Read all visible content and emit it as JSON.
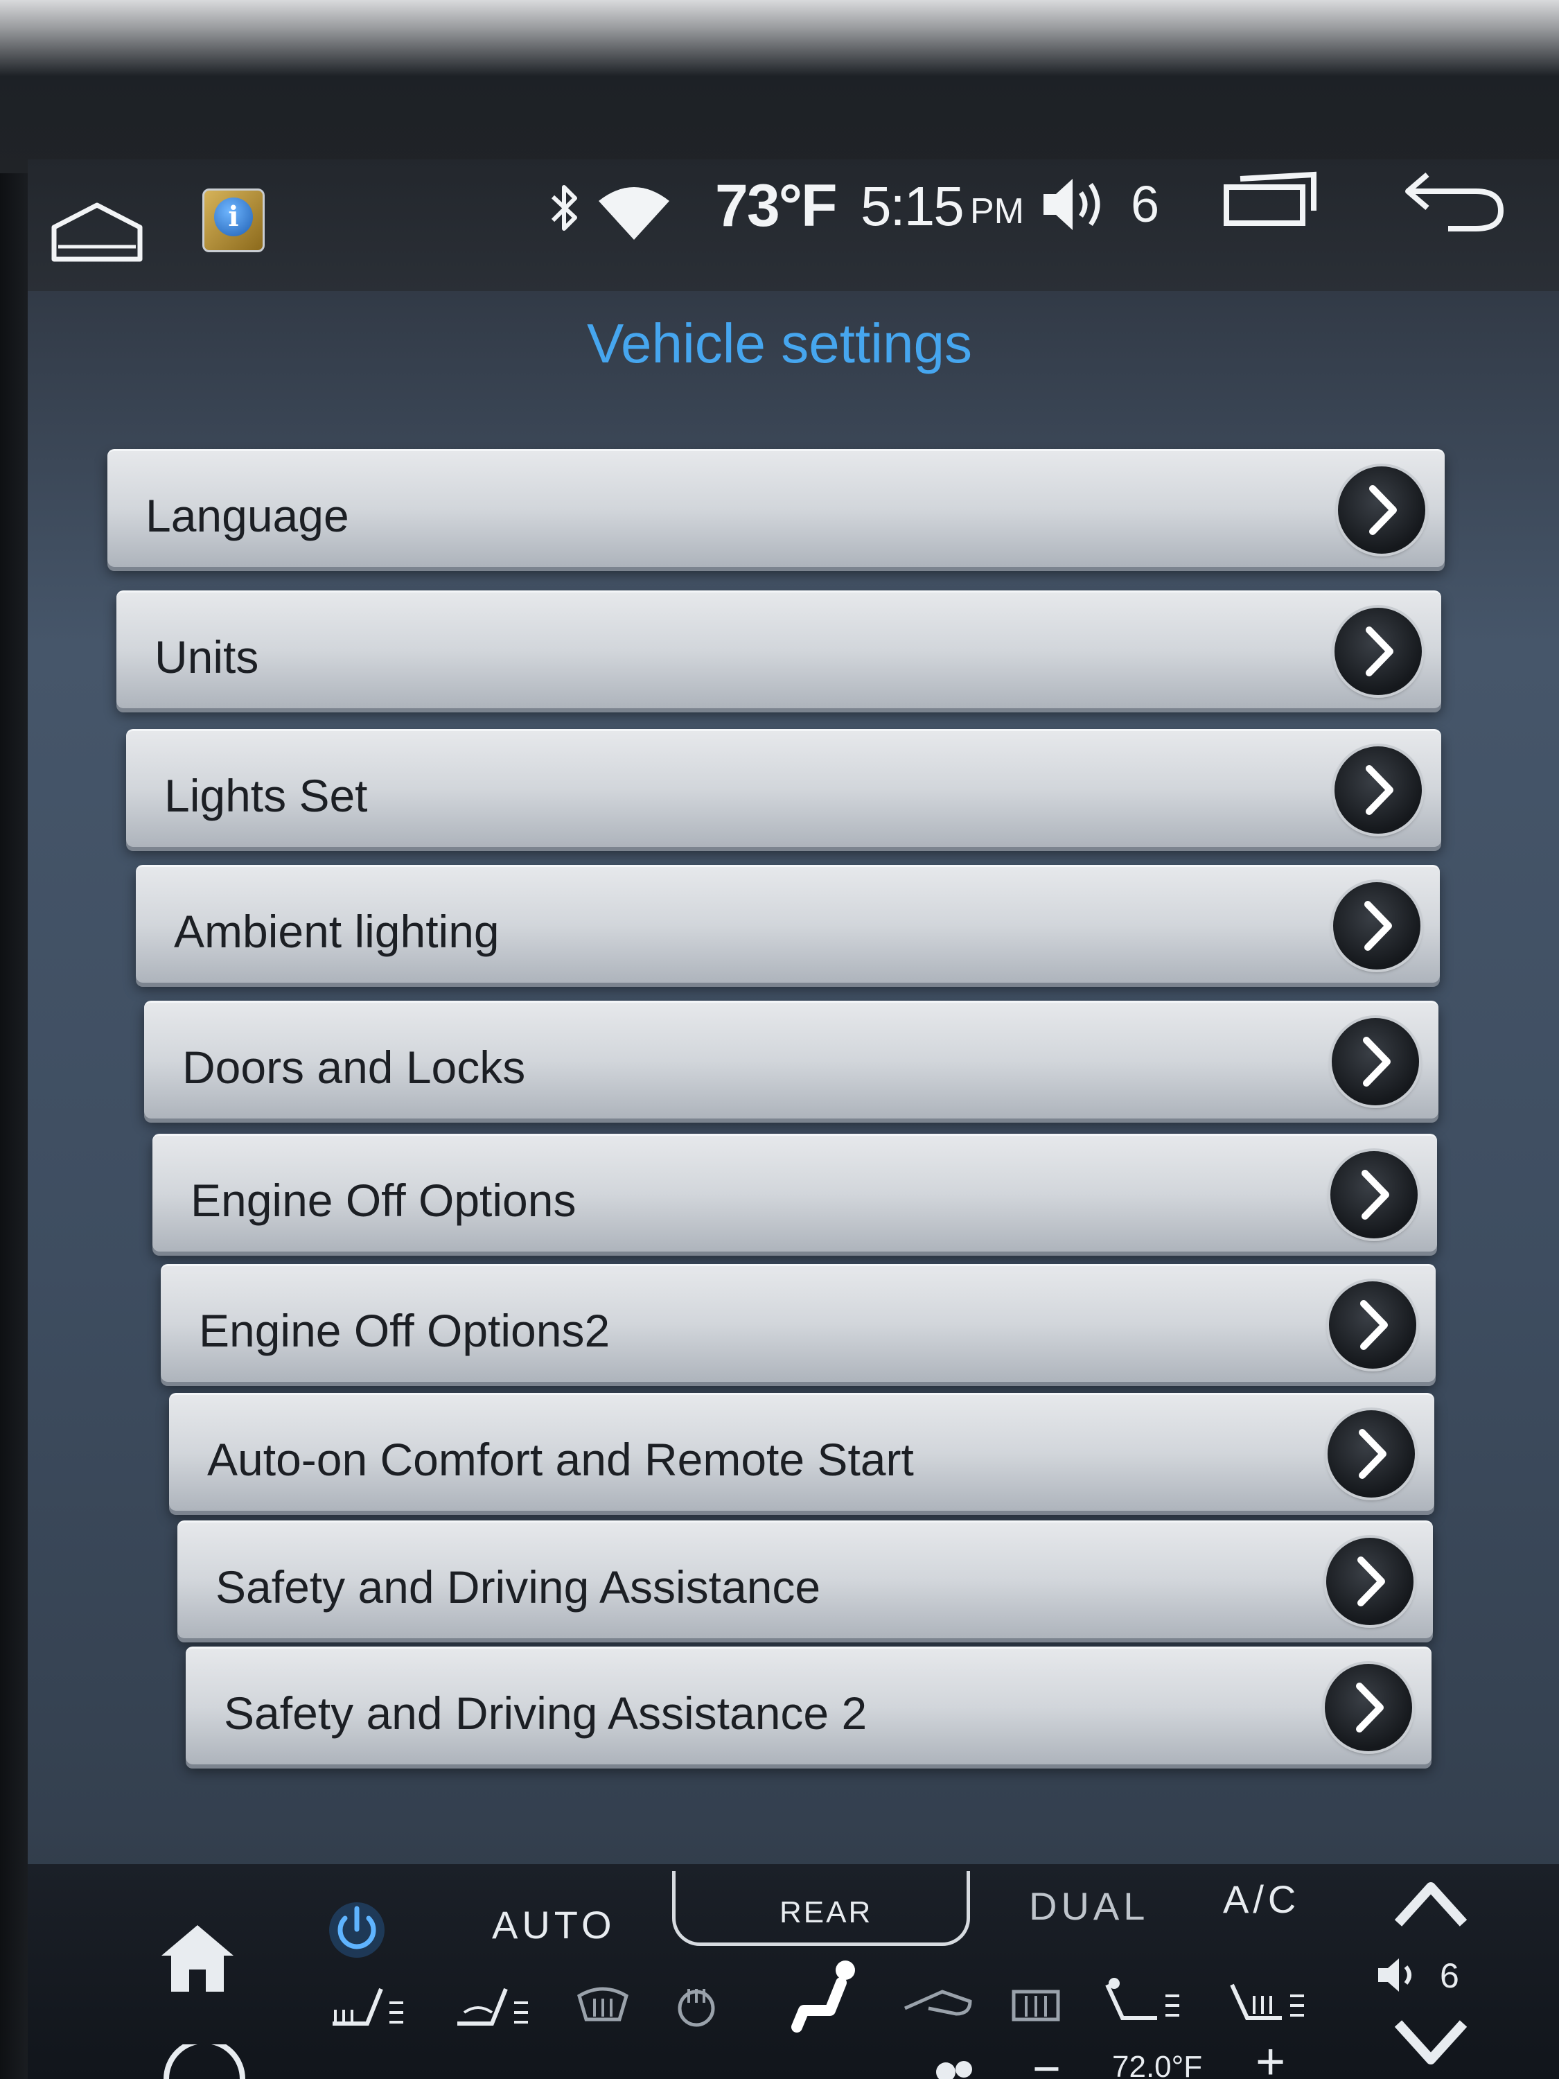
{
  "status_bar": {
    "temperature": "73°F",
    "time": "5:15",
    "ampm": "PM",
    "volume": "6"
  },
  "page": {
    "title": "Vehicle settings"
  },
  "menu": {
    "items": [
      {
        "label": "Language"
      },
      {
        "label": "Units"
      },
      {
        "label": "Lights Set"
      },
      {
        "label": "Ambient lighting"
      },
      {
        "label": "Doors and Locks"
      },
      {
        "label": "Engine Off Options"
      },
      {
        "label": "Engine Off Options2"
      },
      {
        "label": "Auto-on Comfort and Remote Start"
      },
      {
        "label": "Safety and Driving Assistance"
      },
      {
        "label": "Safety and Driving Assistance 2"
      }
    ]
  },
  "climate": {
    "auto_label": "AUTO",
    "rear_label": "REAR",
    "dual_label": "DUAL",
    "ac_label": "A/C",
    "volume": "6",
    "temperature": "72.0°F",
    "plus": "+",
    "minus": "−"
  },
  "colors": {
    "title": "#46a6ef",
    "menu_bg": "#d2d6db",
    "chevron_bg": "#15181c"
  }
}
